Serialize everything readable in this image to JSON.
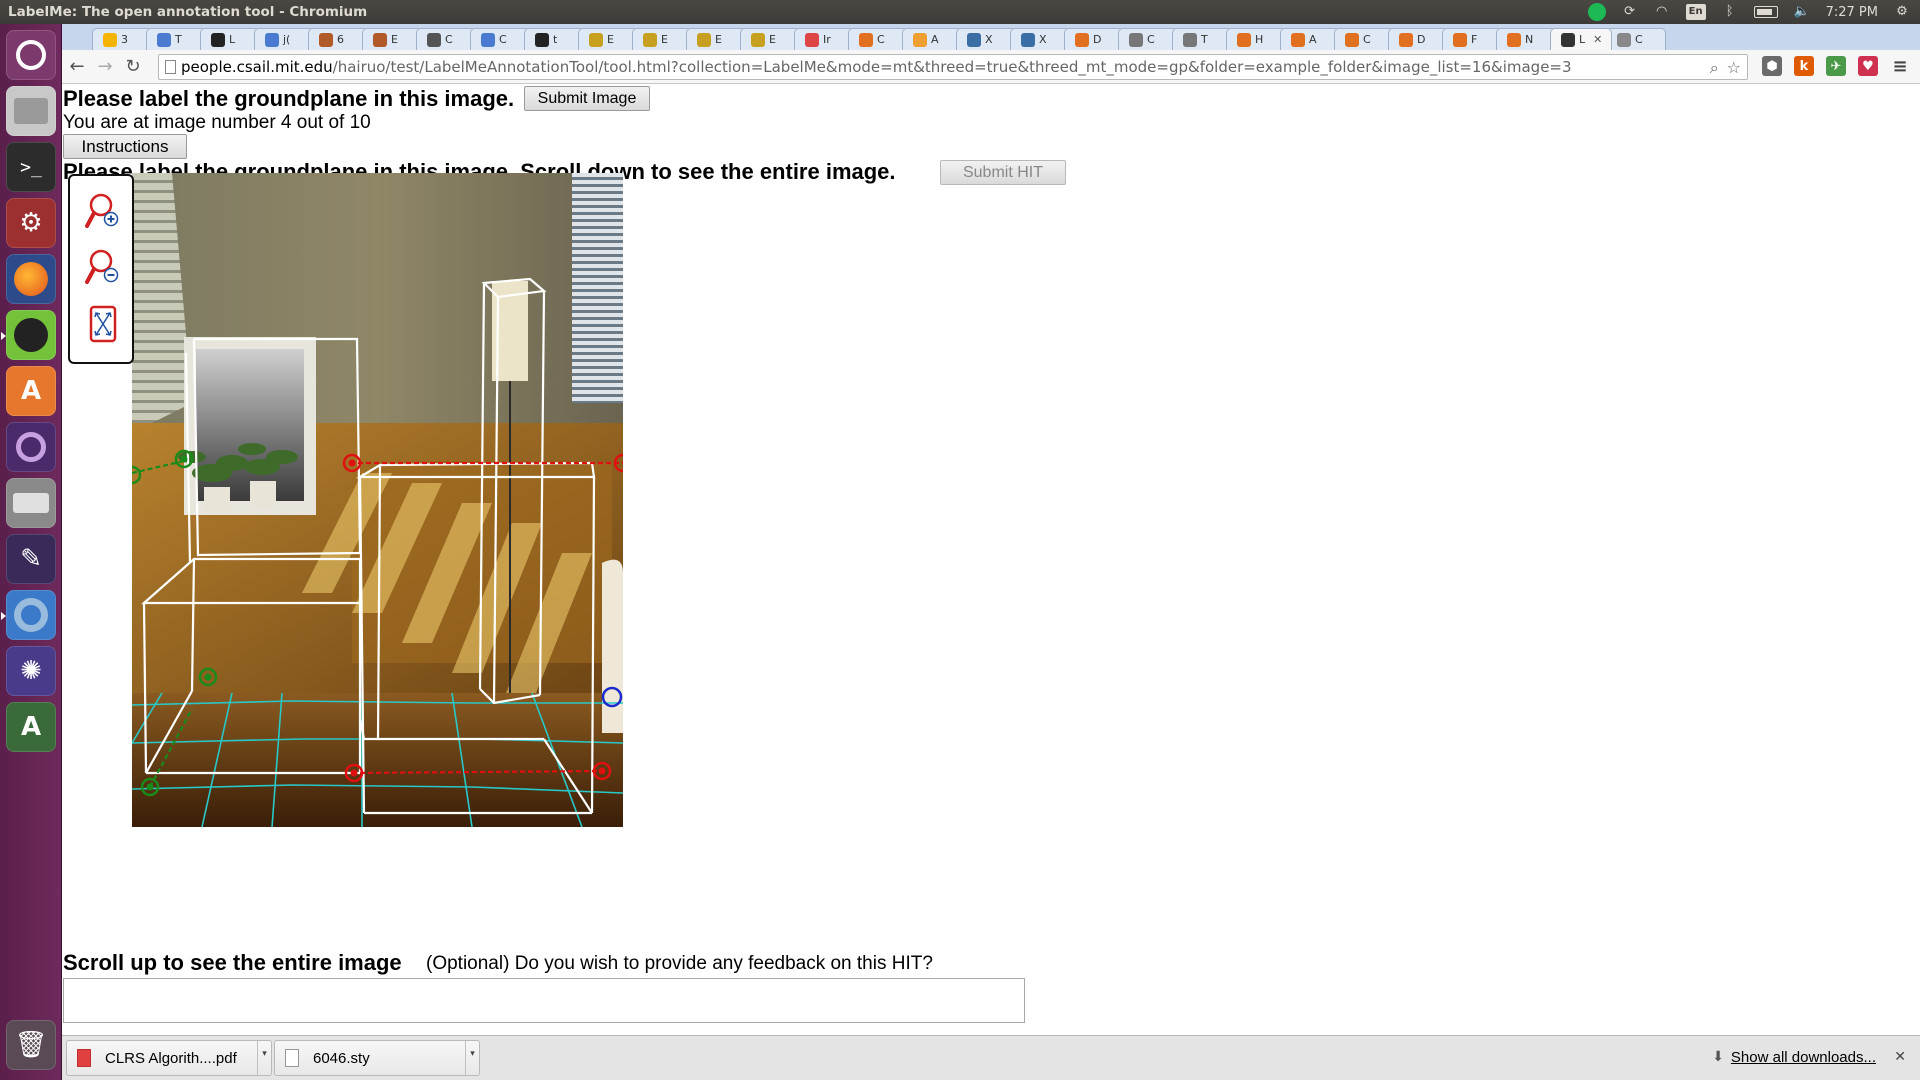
{
  "window": {
    "title": "LabelMe: The open annotation tool - Chromium"
  },
  "panel": {
    "time": "7:27 PM",
    "language": "En"
  },
  "tabs": [
    {
      "label": "3",
      "fav": "#f4b400"
    },
    {
      "label": "T",
      "fav": "#4a7bd0"
    },
    {
      "label": "L",
      "fav": "#222"
    },
    {
      "label": "j(",
      "fav": "#4a7bd0"
    },
    {
      "label": "6",
      "fav": "#b05a2a"
    },
    {
      "label": "E",
      "fav": "#b05a2a"
    },
    {
      "label": "C",
      "fav": "#555"
    },
    {
      "label": "C",
      "fav": "#4a7bd0"
    },
    {
      "label": "t",
      "fav": "#222"
    },
    {
      "label": "E",
      "fav": "#c8a020"
    },
    {
      "label": "E",
      "fav": "#c8a020"
    },
    {
      "label": "E",
      "fav": "#c8a020"
    },
    {
      "label": "E",
      "fav": "#c8a020"
    },
    {
      "label": "Ir",
      "fav": "#d44"
    },
    {
      "label": "C",
      "fav": "#e07020"
    },
    {
      "label": "A",
      "fav": "#f0a030"
    },
    {
      "label": "X",
      "fav": "#3a6ea5"
    },
    {
      "label": "X",
      "fav": "#3a6ea5"
    },
    {
      "label": "D",
      "fav": "#e07020"
    },
    {
      "label": "C",
      "fav": "#777"
    },
    {
      "label": "T",
      "fav": "#777"
    },
    {
      "label": "H",
      "fav": "#e07020"
    },
    {
      "label": "A",
      "fav": "#e07020"
    },
    {
      "label": "C",
      "fav": "#e07020"
    },
    {
      "label": "D",
      "fav": "#e07020"
    },
    {
      "label": "F",
      "fav": "#e07020"
    },
    {
      "label": "N",
      "fav": "#e07020"
    },
    {
      "label": "L",
      "fav": "#333",
      "active": true
    },
    {
      "label": "C",
      "fav": "#888"
    }
  ],
  "omnibox": {
    "host": "people.csail.mit.edu",
    "path": "/hairuo/test/LabelMeAnnotationTool/tool.html?collection=LabelMe&mode=mt&threed=true&threed_mt_mode=gp&folder=example_folder&image_list=16&image=3"
  },
  "page": {
    "heading_top": "Please label the groundplane in this image.",
    "submit_image_label": "Submit Image",
    "progress_text": "You are at image number 4 out of 10",
    "instructions_label": "Instructions",
    "heading_scroll_down": "Please label the groundplane in this image. Scroll down to see the entire image.",
    "submit_hit_label": "Submit HIT",
    "heading_scroll_up": "Scroll up to see the entire image",
    "feedback_label": "(Optional) Do you wish to provide any feedback on this HIT?",
    "feedback_value": ""
  },
  "zoom_tools": [
    "zoom-in-icon",
    "zoom-out-icon",
    "fit-image-icon"
  ],
  "downloads": {
    "items": [
      {
        "name": "CLRS Algorith....pdf",
        "type": "pdf"
      },
      {
        "name": "6046.sty",
        "type": "file"
      }
    ],
    "show_all": "Show all downloads..."
  },
  "colors": {
    "launcher": "#6e2a5c",
    "tabstrip": "#c7d6ec",
    "marker_red": "#e01010",
    "marker_green": "#1a8a1a",
    "marker_blue": "#1a2acc",
    "grid_cyan": "#28c8c8"
  }
}
